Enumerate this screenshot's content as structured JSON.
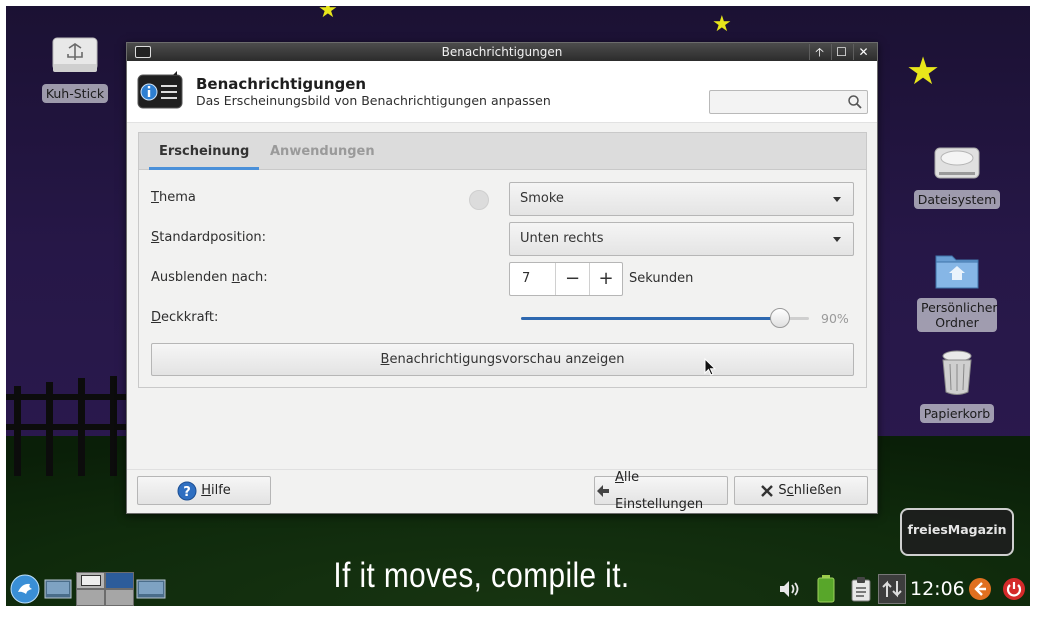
{
  "desktop": {
    "icons": [
      {
        "name": "usb-icon",
        "label": "Kuh-Stick"
      },
      {
        "name": "drive-icon",
        "label": "Dateisystem"
      },
      {
        "name": "home-folder-icon",
        "label": "Persönlicher Ordner"
      },
      {
        "name": "trash-icon",
        "label": "Papierkorb"
      }
    ],
    "slogan": "If it moves, compile it.",
    "badge": "freiesMagazin"
  },
  "window": {
    "title": "Benachrichtigungen",
    "header_title": "Benachrichtigungen",
    "header_subtitle": "Das Erscheinungsbild von Benachrichtigungen anpassen",
    "search_placeholder": ""
  },
  "tabs": [
    {
      "label": "Erscheinung",
      "active": true
    },
    {
      "label": "Anwendungen",
      "active": false
    }
  ],
  "settings": {
    "theme": {
      "label_u": "T",
      "label_rest": "hema",
      "value": "Smoke"
    },
    "position": {
      "label_u": "S",
      "label_rest": "tandardposition:",
      "value": "Unten rechts"
    },
    "hide": {
      "label_pre": "Ausblenden ",
      "label_u": "n",
      "label_rest": "ach:",
      "value": "7",
      "unit": "Sekunden"
    },
    "opacity": {
      "label_u": "D",
      "label_rest": "eckkraft:",
      "value": 90,
      "value_text": "90%"
    },
    "preview": {
      "label_u": "B",
      "label_rest": "enachrichtigungsvorschau anzeigen"
    }
  },
  "footer": {
    "help": {
      "label_u": "H",
      "label_rest": "ilfe"
    },
    "all_settings": {
      "label_u": "A",
      "label_rest": "lle Einstellungen"
    },
    "close": {
      "label_pre": "S",
      "label_u": "c",
      "label_rest": "hließen"
    }
  },
  "panel": {
    "clock": "12:06"
  },
  "colors": {
    "accent": "#4a90d9",
    "slider_fill": "#2e68b0",
    "star": "#e8e61a"
  }
}
